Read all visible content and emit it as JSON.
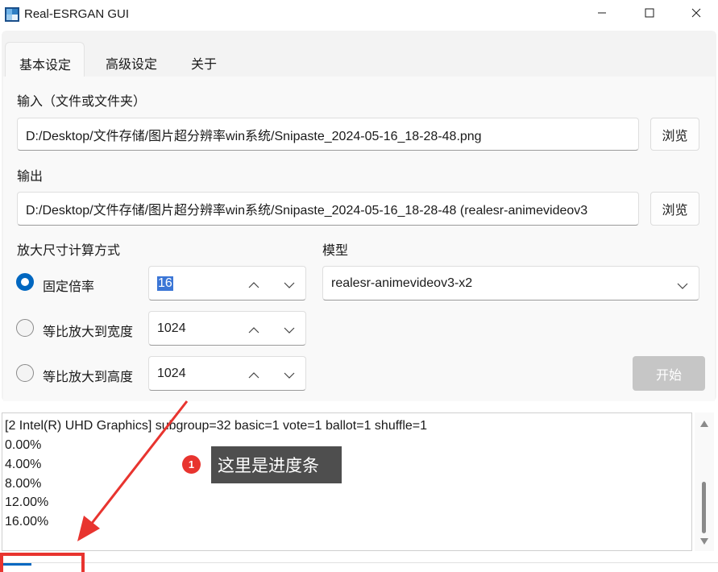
{
  "window": {
    "title": "Real-ESRGAN GUI"
  },
  "tabs": [
    {
      "label": "基本设定",
      "active": true
    },
    {
      "label": "高级设定",
      "active": false
    },
    {
      "label": "关于",
      "active": false
    }
  ],
  "input": {
    "label": "输入（文件或文件夹）",
    "value": "D:/Desktop/文件存储/图片超分辨率win系统/Snipaste_2024-05-16_18-28-48.png",
    "browse_label": "浏览"
  },
  "output": {
    "label": "输出",
    "value": "D:/Desktop/文件存储/图片超分辨率win系统/Snipaste_2024-05-16_18-28-48 (realesr-animevideov3",
    "browse_label": "浏览"
  },
  "scale": {
    "label": "放大尺寸计算方式",
    "options": [
      {
        "label": "固定倍率",
        "selected": true,
        "value": "16"
      },
      {
        "label": "等比放大到宽度",
        "selected": false,
        "value": "1024"
      },
      {
        "label": "等比放大到高度",
        "selected": false,
        "value": "1024"
      }
    ]
  },
  "model": {
    "label": "模型",
    "value": "realesr-animevideov3-x2"
  },
  "start_label": "开始",
  "log": {
    "lines": [
      "[2 Intel(R) UHD Graphics]  subgroup=32  basic=1  vote=1  ballot=1  shuffle=1",
      "0.00%",
      "4.00%",
      "8.00%",
      "12.00%",
      "16.00%"
    ]
  },
  "annotation": {
    "badge": "1",
    "text": "这里是进度条"
  },
  "progress": {
    "fraction": 0.04
  },
  "colors": {
    "accent": "#0067c0",
    "annotation_red": "#e8342f",
    "disabled_button": "#c6c6c6"
  }
}
